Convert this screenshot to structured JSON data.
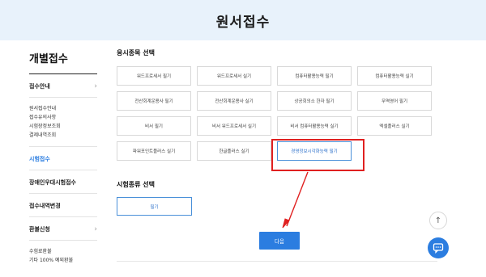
{
  "header": {
    "title": "원서접수"
  },
  "sidebar": {
    "title": "개별접수",
    "groups": [
      {
        "label": "접수안내",
        "items": [
          "원서접수안내",
          "접수유의사항",
          "시험장정보조회",
          "결제내역조회"
        ]
      },
      {
        "label": "시험접수"
      },
      {
        "label": "장애인우대시험접수"
      },
      {
        "label": "접수내역변경"
      },
      {
        "label": "환불신청",
        "items": [
          "수험료환불",
          "기타 100% 예외환불"
        ]
      }
    ]
  },
  "main": {
    "subject_section_title": "응시종목 선택",
    "subjects": [
      "워드프로세서 필기",
      "워드프로세서 실기",
      "컴퓨터활용능력 필기",
      "컴퓨터활용능력 실기",
      "전산회계운용사 필기",
      "전산회계운용사 실기",
      "상공회의소 한자 필기",
      "무역영어 필기",
      "비서 필기",
      "비서 워드프로세서 실기",
      "비서 컴퓨터활용능력 실기",
      "엑셀플러스 실기",
      "파워포인트플러스 실기",
      "한글플러스 실기",
      "경영정보시각화능력 필기"
    ],
    "selected_subject_index": 14,
    "exam_type_section_title": "시험종류 선택",
    "exam_type_option": "필기",
    "next_label": "다음"
  },
  "icons": {
    "chevron": "chevron-right-icon",
    "top": "arrow-up-icon",
    "chat": "chat-icon"
  },
  "colors": {
    "accent": "#2b7de0",
    "annotation": "#e02020",
    "banner_bg": "#e8f2fb"
  }
}
